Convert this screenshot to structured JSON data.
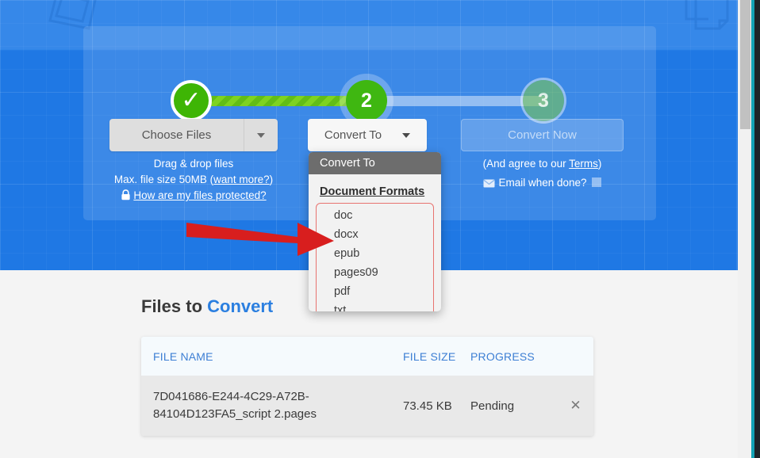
{
  "stepper": {
    "step1_label": "✓",
    "step2_label": "2",
    "step3_label": "3"
  },
  "controls": {
    "choose_files_label": "Choose Files",
    "convert_to_label": "Convert To",
    "convert_now_label": "Convert Now"
  },
  "left_hints": {
    "drag_drop": "Drag & drop files",
    "max_size_prefix": "Max. file size 50MB (",
    "want_more": "want more?",
    "max_size_suffix": ")",
    "protected_link": "How are my files protected?"
  },
  "right_hints": {
    "agree_prefix": "(And agree to our ",
    "terms": "Terms",
    "agree_suffix": ")",
    "email_label": "Email when done?"
  },
  "dropdown": {
    "header": "Convert To",
    "section_title": "Document Formats",
    "items": [
      "doc",
      "docx",
      "epub",
      "pages09",
      "pdf",
      "txt"
    ],
    "highlight_color": "#e8736f"
  },
  "files": {
    "title_plain": "Files to ",
    "title_accent": "Convert",
    "columns": [
      "FILE NAME",
      "FILE SIZE",
      "PROGRESS"
    ],
    "rows": [
      {
        "name": "7D041686-E244-4C29-A72B-84104D123FA5_script 2.pages",
        "size": "73.45 KB",
        "progress": "Pending",
        "remove": "✕"
      }
    ]
  },
  "theme": {
    "hero_blue": "#1f78e4",
    "accent_blue": "#2b7fe0",
    "green_done": "#3eb505",
    "green_current": "#3fb711",
    "annotation_red": "#d81e1e"
  }
}
